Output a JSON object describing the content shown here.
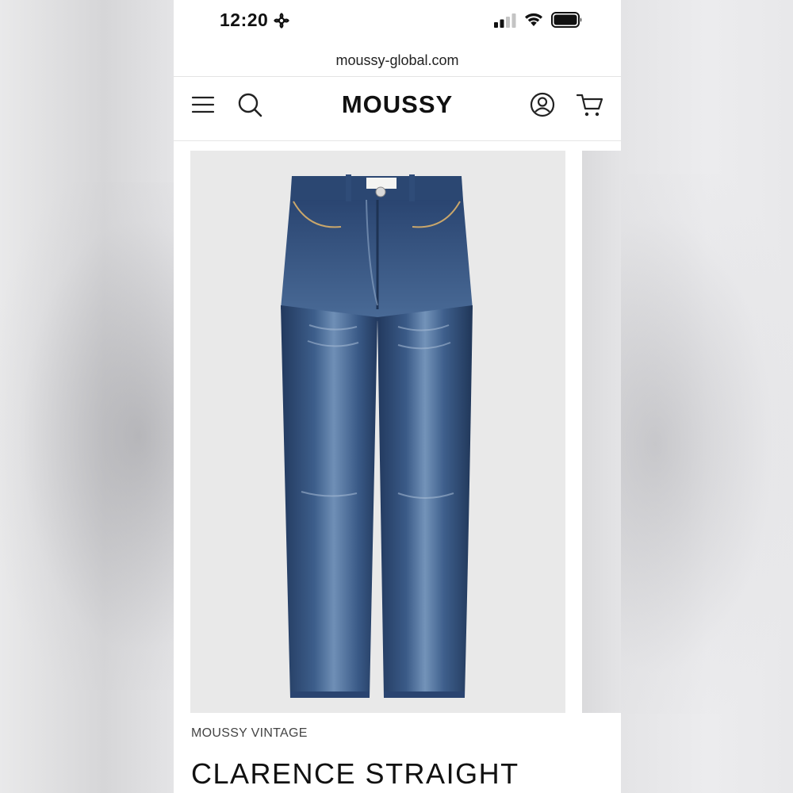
{
  "status_bar": {
    "time": "12:20",
    "icons": [
      "focus-mode-icon",
      "cellular-signal-icon",
      "wifi-icon",
      "battery-icon"
    ]
  },
  "browser": {
    "url": "moussy-global.com"
  },
  "header": {
    "logo": "MOUSSY",
    "icons": [
      "menu-icon",
      "search-icon",
      "account-icon",
      "cart-icon"
    ]
  },
  "product": {
    "brand": "MOUSSY VINTAGE",
    "name": "CLARENCE STRAIGHT",
    "image": "blue-denim-straight-jeans-photo"
  },
  "colors": {
    "denim_dark": "#26416a",
    "denim_mid": "#3e5f8c",
    "denim_light": "#7f9cbe",
    "image_bg": "#e9e9e9",
    "text": "#111111"
  }
}
